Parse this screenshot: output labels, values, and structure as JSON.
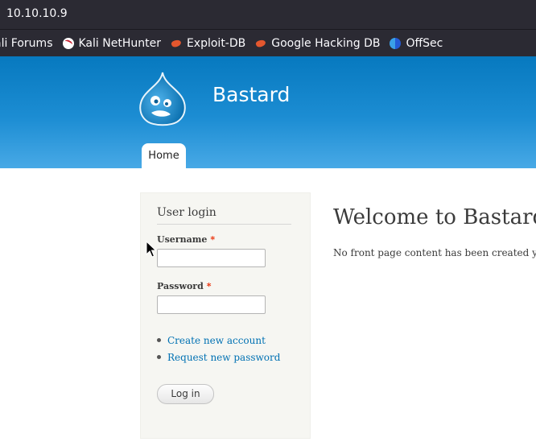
{
  "browser": {
    "url": "10.10.10.9",
    "bookmarks": [
      {
        "label": "ali Forums",
        "icon": "none"
      },
      {
        "label": "Kali NetHunter",
        "icon": "kali-dragon-icon"
      },
      {
        "label": "Exploit-DB",
        "icon": "exploitdb-bug-icon"
      },
      {
        "label": "Google Hacking DB",
        "icon": "exploitdb-bug-icon"
      },
      {
        "label": "OffSec",
        "icon": "offsec-icon"
      }
    ]
  },
  "site": {
    "name": "Bastard",
    "logo": "drupal-drop-logo",
    "nav": {
      "home": "Home"
    }
  },
  "login": {
    "title": "User login",
    "username_label": "Username",
    "password_label": "Password",
    "required_marker": "*",
    "username_value": "",
    "password_value": "",
    "links": [
      "Create new account",
      "Request new password"
    ],
    "submit_label": "Log in"
  },
  "main": {
    "title": "Welcome to Bastard",
    "text": "No front page content has been created yet."
  },
  "colors": {
    "header_top": "#0779bf",
    "header_bottom": "#48a9e6",
    "link": "#0071b3",
    "required": "#ea2800",
    "chrome": "#2b2a33"
  }
}
